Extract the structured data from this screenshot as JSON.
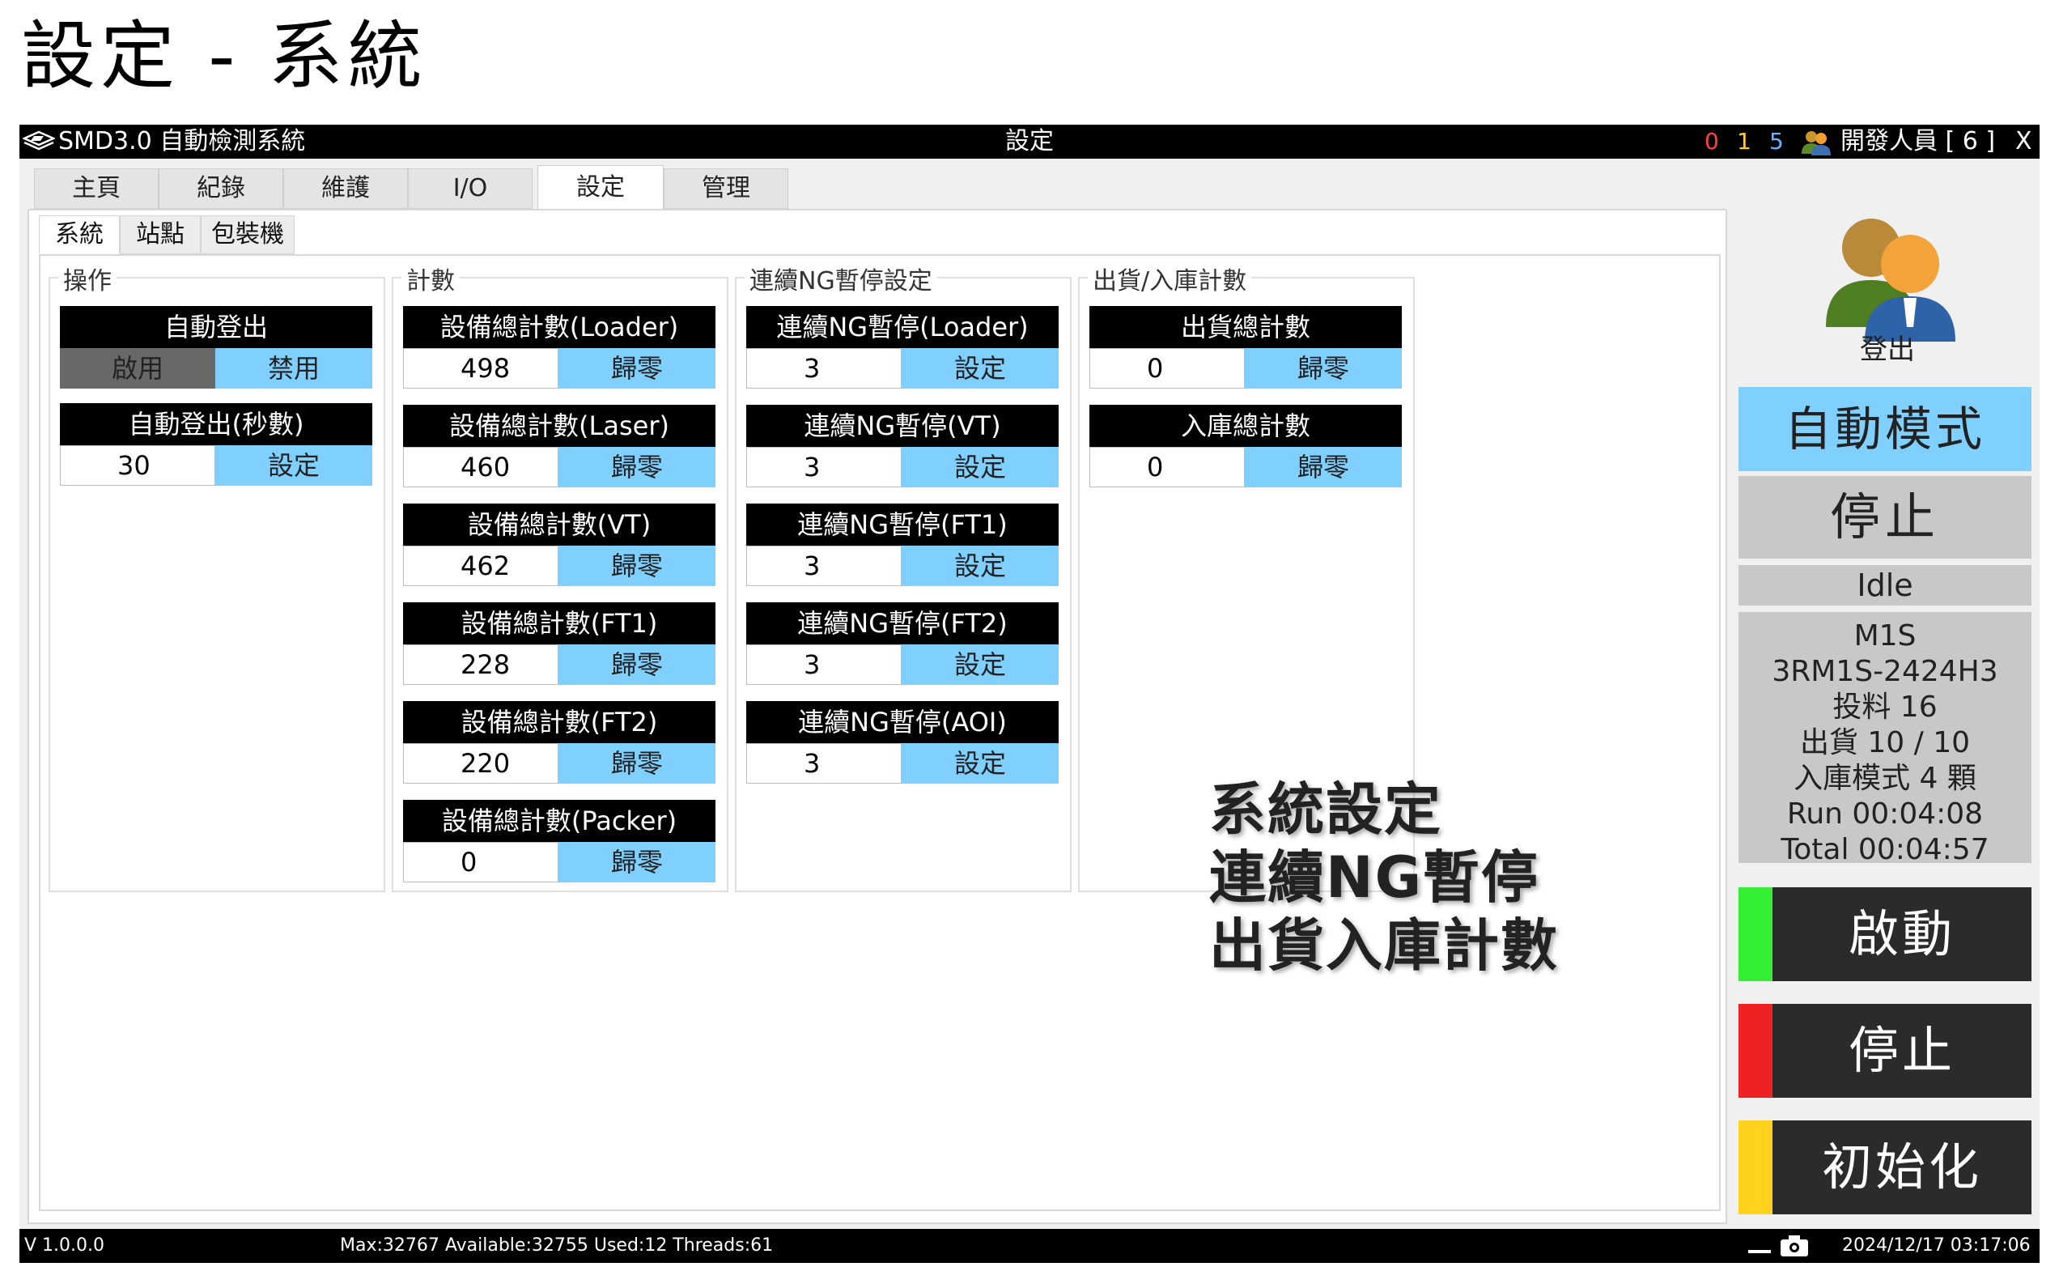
{
  "slide": {
    "title": "設定 - 系統"
  },
  "window": {
    "app_name": "SMD3.0 自動檢測系統",
    "page_title": "設定",
    "counters": [
      {
        "value": "0",
        "color": "#ff4040"
      },
      {
        "value": "1",
        "color": "#ffcc33"
      },
      {
        "value": "5",
        "color": "#66b3ff"
      }
    ],
    "user": "開發人員 [ 6 ]",
    "close": "X"
  },
  "main_tabs": [
    {
      "label": "主頁"
    },
    {
      "label": "紀錄"
    },
    {
      "label": "維護"
    },
    {
      "label": "I/O"
    },
    {
      "label": "設定",
      "active": true
    },
    {
      "label": "管理"
    }
  ],
  "sub_tabs": [
    {
      "label": "系統",
      "active": true
    },
    {
      "label": "站點"
    },
    {
      "label": "包裝機"
    }
  ],
  "groups": {
    "operation": {
      "title": "操作",
      "auto_logout": {
        "header": "自動登出",
        "enable": "啟用",
        "disable": "禁用"
      },
      "auto_logout_sec": {
        "header": "自動登出(秒數)",
        "value": "30",
        "button": "設定"
      }
    },
    "count": {
      "title": "計數",
      "items": [
        {
          "header": "設備總計數(Loader)",
          "value": "498",
          "button": "歸零"
        },
        {
          "header": "設備總計數(Laser)",
          "value": "460",
          "button": "歸零"
        },
        {
          "header": "設備總計數(VT)",
          "value": "462",
          "button": "歸零"
        },
        {
          "header": "設備總計數(FT1)",
          "value": "228",
          "button": "歸零"
        },
        {
          "header": "設備總計數(FT2)",
          "value": "220",
          "button": "歸零"
        },
        {
          "header": "設備總計數(Packer)",
          "value": "0",
          "button": "歸零"
        }
      ]
    },
    "ng_pause": {
      "title": "連續NG暫停設定",
      "items": [
        {
          "header": "連續NG暫停(Loader)",
          "value": "3",
          "button": "設定"
        },
        {
          "header": "連續NG暫停(VT)",
          "value": "3",
          "button": "設定"
        },
        {
          "header": "連續NG暫停(FT1)",
          "value": "3",
          "button": "設定"
        },
        {
          "header": "連續NG暫停(FT2)",
          "value": "3",
          "button": "設定"
        },
        {
          "header": "連續NG暫停(AOI)",
          "value": "3",
          "button": "設定"
        }
      ]
    },
    "ship": {
      "title": "出貨/入庫計數",
      "items": [
        {
          "header": "出貨總計數",
          "value": "0",
          "button": "歸零"
        },
        {
          "header": "入庫總計數",
          "value": "0",
          "button": "歸零"
        }
      ]
    }
  },
  "overlay_note": [
    "系統設定",
    "連續NG暫停",
    "出貨入庫計數"
  ],
  "right_panel": {
    "logout": "登出",
    "mode": "自動模式",
    "stop_mode": "停止",
    "state": "Idle",
    "info": [
      "M1S",
      "3RM1S-2424H3",
      "投料 16",
      "出貨 10 / 10",
      "入庫模式 4 顆",
      "Run 00:04:08",
      "Total 00:04:57"
    ],
    "start": {
      "label": "啟動",
      "color": "#33ee33"
    },
    "stop": {
      "label": "停止",
      "color": "#ee2222"
    },
    "init": {
      "label": "初始化",
      "color": "#ffd21f"
    }
  },
  "statusbar": {
    "version": "V 1.0.0.0",
    "memory": "Max:32767 Available:32755 Used:12 Threads:61",
    "datetime": "2024/12/17 03:17:06"
  }
}
